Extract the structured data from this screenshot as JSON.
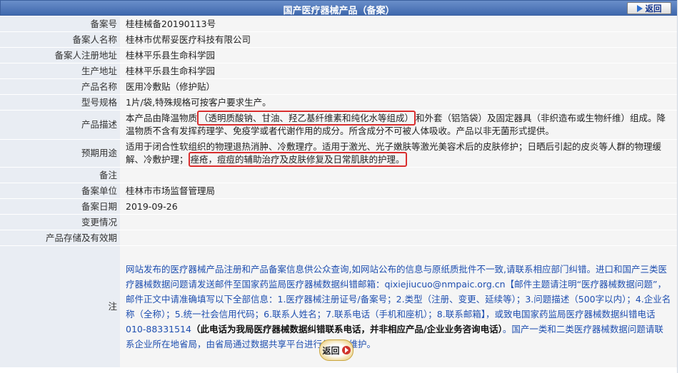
{
  "header": {
    "title": "国产医疗器械产品（备案）",
    "back_label": "返回"
  },
  "fields": {
    "record_no_label": "备案号",
    "record_no": "桂桂械备20190113号",
    "applicant_label": "备案人名称",
    "applicant": "桂林市优帮妥医疗科技有限公司",
    "address_label": "备案人注册地址",
    "address": "桂林平乐县生命科学园",
    "prod_addr_label": "生产地址",
    "prod_addr": "桂林平乐县生命科学园",
    "name_label": "产品名称",
    "name": "医用冷敷贴（修护贴）",
    "model_label": "型号规格",
    "model": "1片/袋,特殊规格可按客户要求生产。",
    "desc_label": "产品描述",
    "desc_pre": "本产品由降温物质",
    "desc_hl": "（透明质酸钠、甘油、羟乙基纤维素和纯化水等组成）",
    "desc_post": "和外套（铝箔袋）及固定器具（非织造布或生物纤维）组成。降温物质不含有发挥药理学、免疫学或者代谢作用的成分。所含成分不可被人体吸收。产品以非无菌形式提供。",
    "use_label": "预期用途",
    "use_pre": "适用于闭合性软组织的物理退热消肿、冷敷理疗。适用于激光、光子嫩肤等激光美容术后的皮肤修护；日晒后引起的皮炎等人群的物理缓解、冷敷护理；",
    "use_hl": "痤疮，痘痘的辅助治疗及皮肤修复及日常肌肤的护理。",
    "remark_label": "备注",
    "remark": "",
    "unit_label": "备案单位",
    "unit": "桂林市市场监督管理局",
    "date_label": "备案日期",
    "date": "2019-09-26",
    "change_label": "变更情况",
    "change": "",
    "storage_label": "产品存储及有效期",
    "storage": ""
  },
  "note": {
    "label": "注",
    "p1": "网站发布的医疗器械产品注册和产品备案信息供公众查询,如网站公布的信息与原纸质批件不一致,请联系相应部门纠错。进口和国产三类医疗器械数据问题请发送邮件至国家药监局医疗器械数据纠错邮箱：qixiejiucuo@nmpaic.org.cn【邮件主题请注明“医疗器械数据问题”，邮件正文中请准确填写以下全部信息：1.医疗器械注册证号/备案号；2.类型（注册、变更、延续等）；3.问题描述（500字以内）；4.企业名称（全称）；5.统一社会信用代码；6.联系人姓名；7.联系电话（手机和座机）；8.联系邮箱】，或致电国家药监局医疗器械数据纠错电话010-88331514",
    "p_bold": "（此电话为我局医疗器械数据纠错联系电话，并非相应产品/企业业务咨询电话）",
    "p2": "。国产一类和二类医疗器械数据问题请联系企业所在地省局，由省局通过数据共享平台进行纠错和维护。"
  },
  "footer": {
    "back_label": "返回"
  },
  "colors": {
    "header_bg": "#4a72b5",
    "label_bg": "#e9edf3",
    "value_bg": "#f5f5f5",
    "note_text": "#1f4fb0",
    "highlight": "#d92e2e"
  }
}
